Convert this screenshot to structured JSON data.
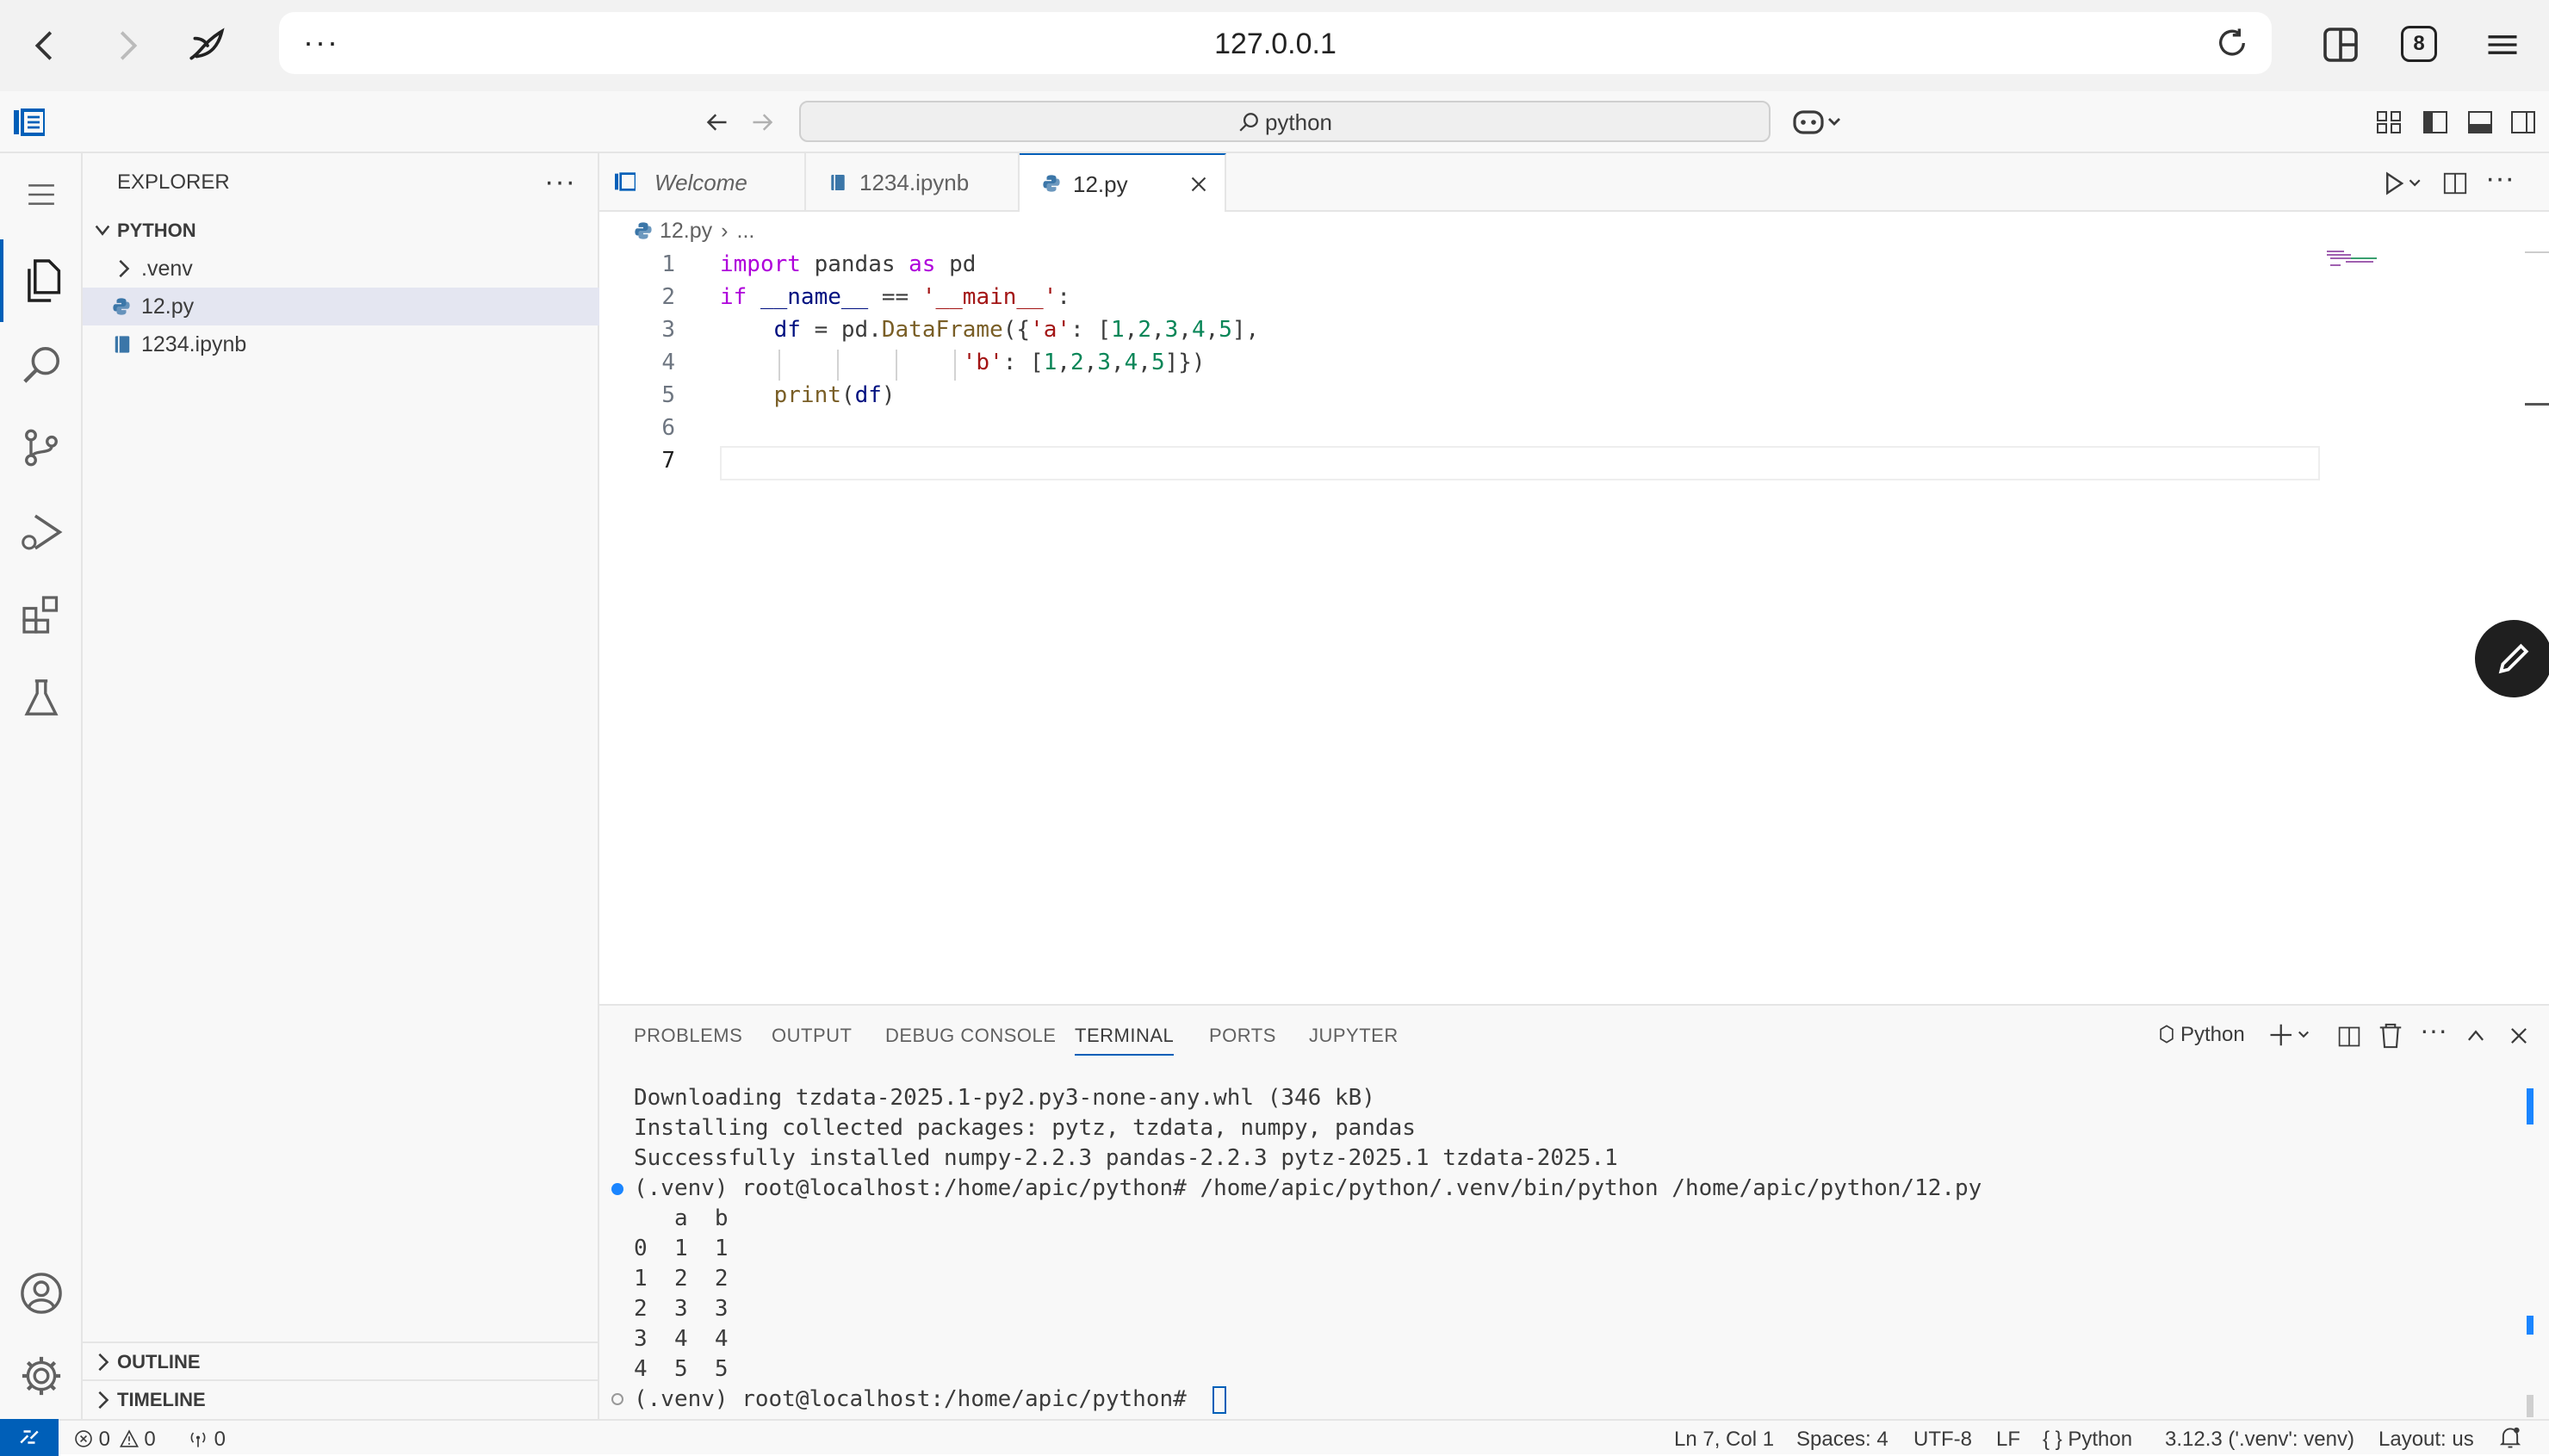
{
  "browser": {
    "url": "127.0.0.1",
    "tab_count": "8"
  },
  "titlebar": {
    "search": "python"
  },
  "sidebar": {
    "title": "EXPLORER",
    "folder": "PYTHON",
    "items": [
      {
        "label": ".venv"
      },
      {
        "label": "12.py"
      },
      {
        "label": "1234.ipynb"
      }
    ],
    "outline": "OUTLINE",
    "timeline": "TIMELINE"
  },
  "tabs": [
    {
      "label": "Welcome"
    },
    {
      "label": "1234.ipynb"
    },
    {
      "label": "12.py"
    }
  ],
  "breadcrumb": {
    "file": "12.py",
    "rest": "..."
  },
  "editor": {
    "line_numbers": [
      "1",
      "2",
      "3",
      "4",
      "5",
      "6",
      "7"
    ]
  },
  "panel": {
    "tabs": [
      "PROBLEMS",
      "OUTPUT",
      "DEBUG CONSOLE",
      "TERMINAL",
      "PORTS",
      "JUPYTER"
    ],
    "terminal_profile": "Python",
    "lines": [
      "Downloading tzdata-2025.1-py2.py3-none-any.whl (346 kB)",
      "Installing collected packages: pytz, tzdata, numpy, pandas",
      "Successfully installed numpy-2.2.3 pandas-2.2.3 pytz-2025.1 tzdata-2025.1",
      "(.venv) root@localhost:/home/apic/python# /home/apic/python/.venv/bin/python /home/apic/python/12.py",
      "   a  b",
      "0  1  1",
      "1  2  2",
      "2  3  3",
      "3  4  4",
      "4  5  5",
      "(.venv) root@localhost:/home/apic/python# "
    ]
  },
  "status": {
    "errors": "0",
    "warnings": "0",
    "ports": "0",
    "position": "Ln 7, Col 1",
    "spaces": "Spaces: 4",
    "encoding": "UTF-8",
    "eol": "LF",
    "language": "Python",
    "interpreter": "3.12.3 ('.venv': venv)",
    "layout": "Layout: us"
  }
}
